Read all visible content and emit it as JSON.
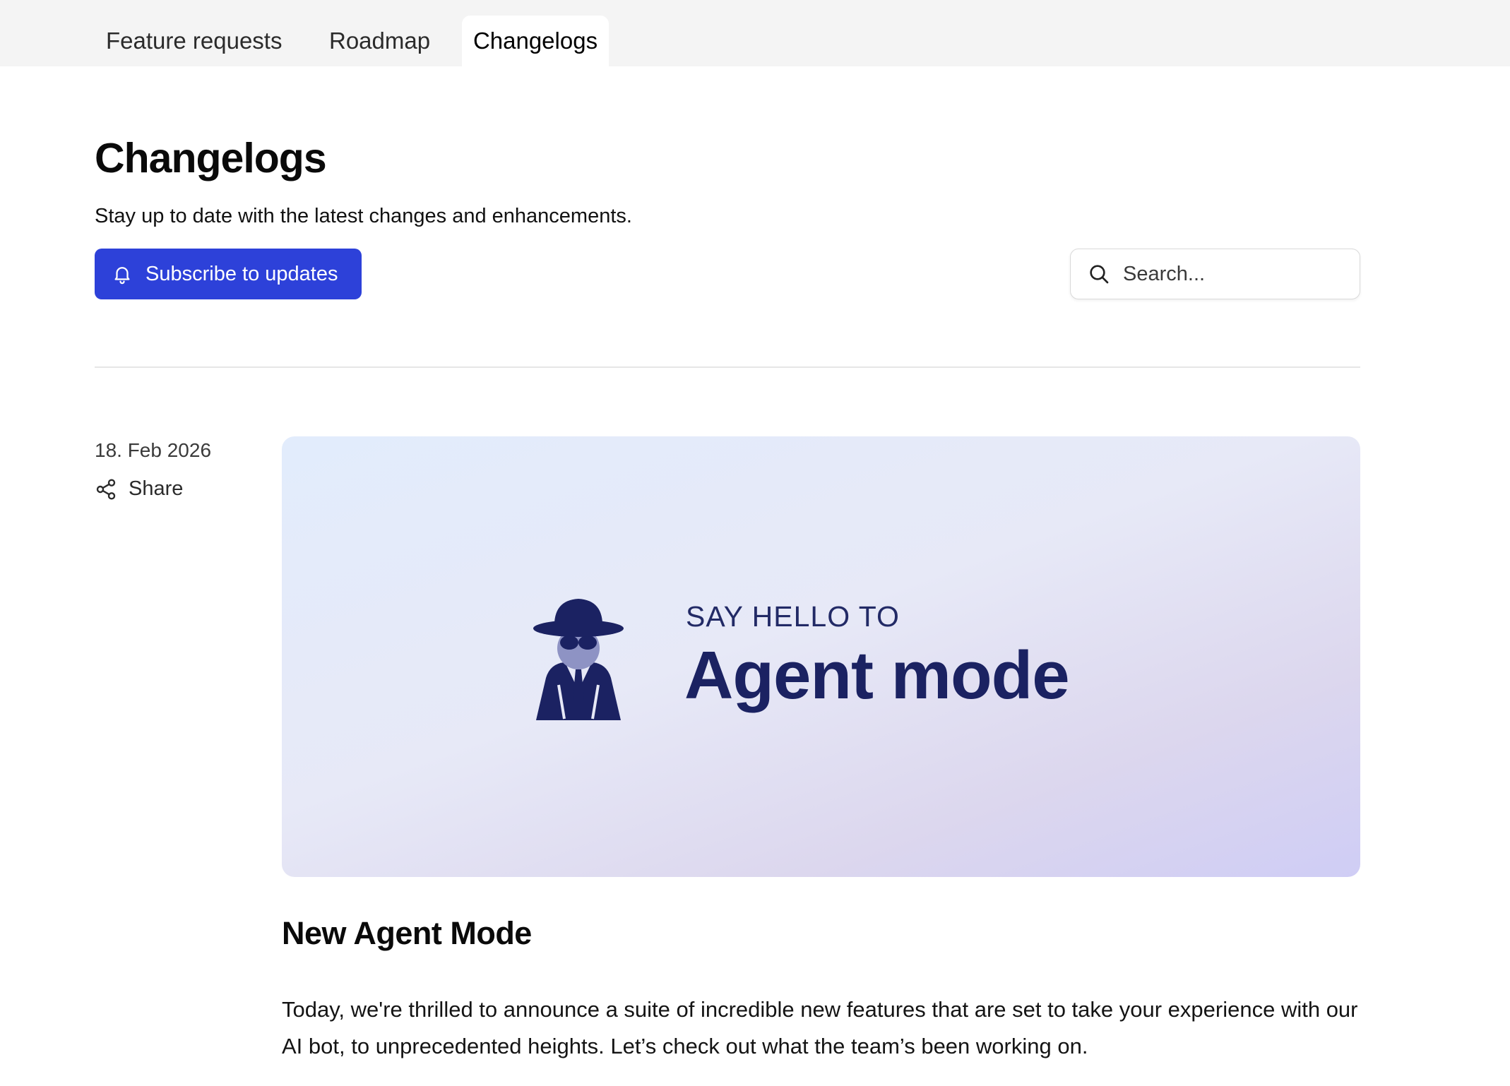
{
  "tabs": [
    {
      "label": "Feature requests",
      "active": false
    },
    {
      "label": "Roadmap",
      "active": false
    },
    {
      "label": "Changelogs",
      "active": true
    }
  ],
  "header": {
    "title": "Changelogs",
    "subtitle": "Stay up to date with the latest changes and enhancements.",
    "subscribe_label": "Subscribe to updates",
    "subscribe_icon": "bell-icon"
  },
  "search": {
    "placeholder": "Search...",
    "value": "",
    "icon": "search-icon"
  },
  "entry": {
    "date": "18. Feb 2026",
    "share_label": "Share",
    "share_icon": "share-icon",
    "banner": {
      "eyebrow": "SAY HELLO TO",
      "headline": "Agent mode",
      "figure_icon": "agent-spy-icon"
    },
    "title": "New Agent Mode",
    "body": "Today, we're thrilled to announce a suite of incredible new features that are set to take your experience with our AI bot, to unprecedented heights. Let’s check out what the team’s been working on."
  },
  "colors": {
    "accent": "#2d41d9",
    "tabbar_bg": "#f4f4f4",
    "banner_text": "#1b2262"
  }
}
